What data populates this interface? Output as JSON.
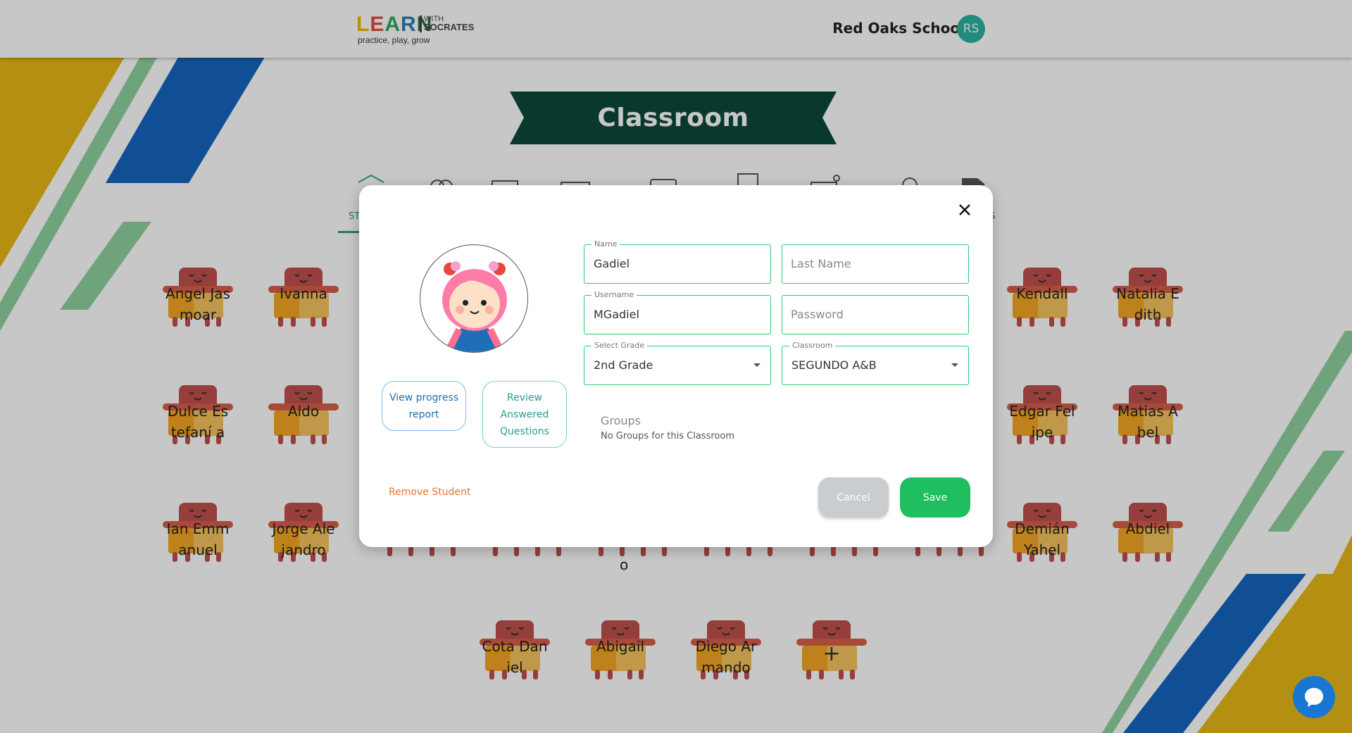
{
  "header": {
    "logo": {
      "learn": [
        "L",
        "E",
        "A",
        "R",
        "N"
      ],
      "learn_colors": [
        "#f2b705",
        "#e74c3c",
        "#27ae60",
        "#2980b9",
        "#2c6e49"
      ],
      "with": "WITH",
      "socrates": "SOCRATES",
      "tagline": "practice, play, grow"
    },
    "school_name": "Red Oaks School",
    "user_initials": "RS"
  },
  "banner": {
    "title": "Classroom"
  },
  "tabs": {
    "partial_label_left": "ST",
    "partial_label_right": "S"
  },
  "desks": [
    {
      "name": "Angel Jasmoar"
    },
    {
      "name": "Ivanna"
    },
    {
      "name": "Kendall"
    },
    {
      "name": "Natalia Edith"
    },
    {
      "name": "Dulce Estefaní a"
    },
    {
      "name": "Aldo"
    },
    {
      "name": "Edgar Felipe"
    },
    {
      "name": "Matias Abel"
    },
    {
      "name": "Ian Emmanuel"
    },
    {
      "name": "Jorge Alejandro"
    },
    {
      "name": "Demián Yahel"
    },
    {
      "name": "Abdiel"
    },
    {
      "name": "Cota Daniel"
    },
    {
      "name": "Abigail"
    },
    {
      "name": "Diego Armando"
    }
  ],
  "add_desk_symbol": "+",
  "partial_behind_modal": "o",
  "modal": {
    "view_progress_label": "View progress report",
    "review_answered_label": "Review Answered Questions",
    "remove_student_label": "Remove Student",
    "name": {
      "label": "Name",
      "value": "Gadiel"
    },
    "last_name": {
      "placeholder": "Last Name"
    },
    "username": {
      "label": "Username",
      "value": "MGadiel"
    },
    "password": {
      "placeholder": "Password"
    },
    "grade": {
      "label": "Select Grade",
      "value": "2nd Grade"
    },
    "classroom": {
      "label": "Classroom",
      "value": "SEGUNDO A&B"
    },
    "groups": {
      "title": "Groups",
      "empty_message": "No Groups for this Classroom"
    },
    "cancel_label": "Cancel",
    "save_label": "Save"
  },
  "colors": {
    "banner_green": "#0c4a3a",
    "accent_green": "#1fbf5f",
    "field_border": "#2ecc71",
    "remove_orange": "#e8742c",
    "bg_yellow": "#e8b816",
    "bg_blue": "#1565c0",
    "bg_light_green": "#8fd19e",
    "avatar_teal": "#2bb3a0",
    "chat_blue": "#1976d2"
  },
  "icons": [
    "close-icon",
    "chat-icon",
    "chevron-down-icon",
    "girl-avatar-icon",
    "desk-icon",
    "plus-icon"
  ]
}
